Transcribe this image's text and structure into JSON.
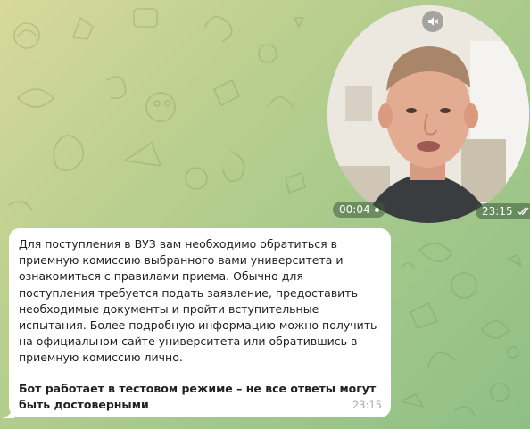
{
  "video_message": {
    "duration": "00:04",
    "time": "23:15",
    "mute_icon": "speaker-muted-icon",
    "status_icon": "double-check-icon"
  },
  "bot_message": {
    "text": "Для поступления в ВУЗ вам необходимо обратиться в приемную комиссию выбранного вами университета и ознакомиться с правилами приема. Обычно для поступления требуется подать заявление, предоставить необходимые документы и пройти вступительные испытания. Более подробную информацию можно получить на официальном сайте университета или обратившись в приемную комиссию лично.",
    "warning": "Бот работает в тестовом режиме – не все ответы могут быть достоверными",
    "time": "23:15"
  },
  "colors": {
    "bubble": "#ffffff",
    "background": "#b9cf8f",
    "timestamp": "#a1aab3"
  }
}
